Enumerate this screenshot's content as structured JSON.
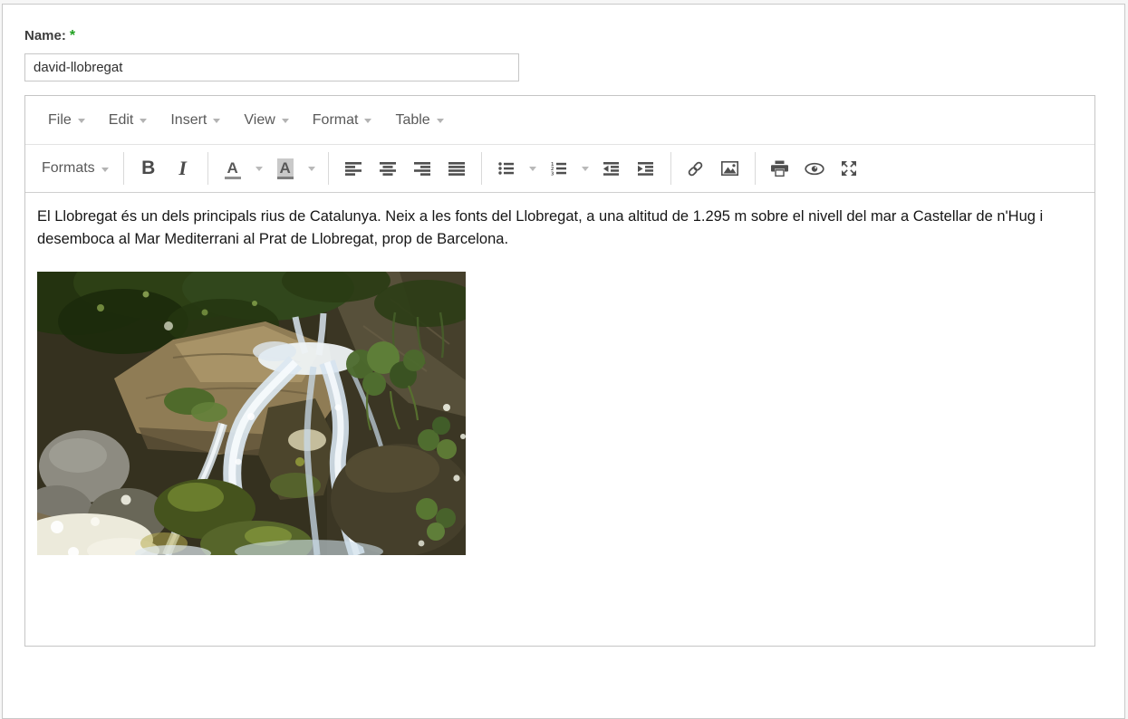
{
  "page": {
    "background": "#ffffff",
    "frame_border_color": "#c9c9c9"
  },
  "form": {
    "name_label": "Name:",
    "required_marker": "*",
    "required_color": "#21a121",
    "name_value": "david-llobregat"
  },
  "editor": {
    "menubar": {
      "items": [
        {
          "label": "File"
        },
        {
          "label": "Edit"
        },
        {
          "label": "Insert"
        },
        {
          "label": "View"
        },
        {
          "label": "Format"
        },
        {
          "label": "Table"
        }
      ]
    },
    "toolbar": {
      "formats_label": "Formats",
      "bold_label": "B",
      "italic_label": "I",
      "forecolor_label": "A",
      "backcolor_label": "A",
      "icon_names": [
        "chevron-down-icon",
        "align-left-icon",
        "align-center-icon",
        "align-right-icon",
        "align-justify-icon",
        "bullet-list-icon",
        "numbered-list-icon",
        "outdent-icon",
        "indent-icon",
        "link-icon",
        "image-icon",
        "print-icon",
        "preview-eye-icon",
        "fullscreen-icon"
      ],
      "icon_color": "#4f4f4f",
      "divider_color": "#d9d9d9"
    },
    "content": {
      "paragraph": "El Llobregat és un dels principals rius de Catalunya. Neix a les fonts del Llobregat, a una altitud de 1.295 m sobre el nivell del mar a Castellar de n'Hug i desemboca al Mar Mediterrani al Prat de Llobregat, prop de Barcelona.",
      "image_description": "Waterfall cascading in white streams over dark mossy rocks, with tan boulders, green shrubs and sunlit gray stones"
    }
  }
}
